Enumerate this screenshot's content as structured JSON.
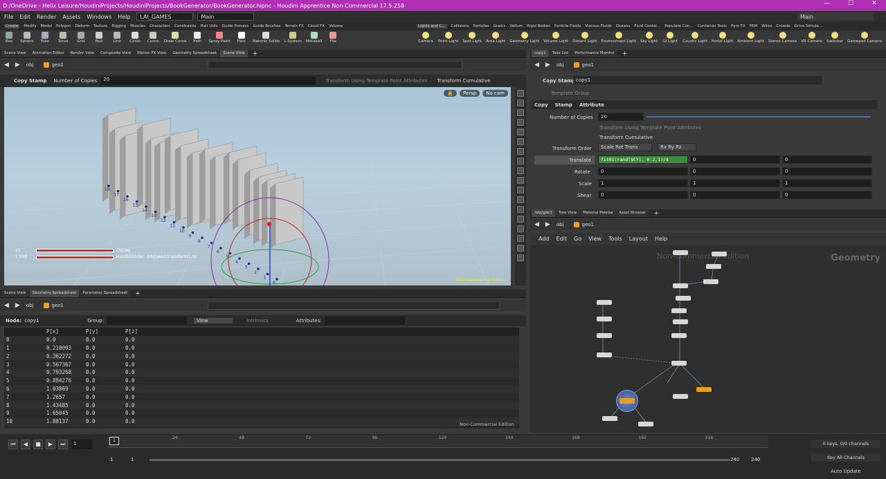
{
  "window": {
    "title": "D:/OneDrive - Helix Leisure/HoudiniProjects/HoudiniProjects/BookGenerator/BookGenerator.hipnc - Houdini Apprentice Non-Commercial 17.5.258"
  },
  "menu": {
    "items": [
      "File",
      "Edit",
      "Render",
      "Assets",
      "Windows",
      "Help"
    ],
    "desktop": "LAI_GAMES",
    "context": "Main",
    "right_context": "Main"
  },
  "shelf": {
    "tabs": [
      "Create",
      "Modify",
      "Model",
      "Polygon",
      "Deform",
      "Texture",
      "Rigging",
      "Muscles",
      "Characters",
      "Constraints",
      "Hair Utils",
      "Guide Process",
      "Guide Brushes",
      "Terrain FX",
      "Cloud FX",
      "Volume"
    ],
    "tools": [
      "Box",
      "Sphere",
      "Tube",
      "Torus",
      "Grid",
      "Null",
      "Line",
      "Circle",
      "Curve",
      "Draw Curve",
      "Path",
      "Spray Paint",
      "Font",
      "Platonic Solids",
      "L-System",
      "Metaball",
      "File"
    ],
    "tabs2": [
      "Lights and C...",
      "Collisions",
      "Particles",
      "Grains",
      "Vellum",
      "Rigid Bodies",
      "Particle Fluids",
      "Viscous Fluids",
      "Oceans",
      "Fluid Contai...",
      "Populate Con...",
      "Container Tools",
      "Pyro FX",
      "FEM",
      "Wires",
      "Crowds",
      "Drive Simula..."
    ],
    "tools2": [
      "Camera",
      "Point Light",
      "Spot Light",
      "Area Light",
      "Geometry Light",
      "Volume Light",
      "Distant Light",
      "Environment Light",
      "Sky Light",
      "GI Light",
      "Caustic Light",
      "Portal Light",
      "Ambient Light",
      "Stereo Camera",
      "VR Camera",
      "Switcher",
      "Gamepad Camera"
    ]
  },
  "left_pane": {
    "tabs": [
      "Scene View",
      "Animation Editor",
      "Render View",
      "Composite View",
      "Motion FX View",
      "Geometry Spreadsheet",
      "Scene View"
    ],
    "path": [
      "obj",
      "geo1"
    ]
  },
  "viewport": {
    "node_label": "Copy Stamp",
    "copies_label": "Number of Copies",
    "copies_value": "20",
    "opt1": "Transform Using Template Point Attributes",
    "opt2": "Transform Cumulative",
    "persp": "Persp",
    "cam": "No cam",
    "watermark": "Non-Commercial Edition",
    "hud_value1": "20",
    "hud_value2": "1.000",
    "hud_label1": "Copies",
    "hud_label2": "HoudiniSlider: /obj/geo1/transform1:sx",
    "point_labels": [
      "18",
      "17",
      "16",
      "15",
      "14",
      "13",
      "12",
      "11",
      "10",
      "9",
      "8",
      "7",
      "6",
      "5",
      "4",
      "3",
      "2",
      "1",
      "0"
    ]
  },
  "spreadsheet": {
    "tabs": [
      "Scene View",
      "Geometry Spreadsheet",
      "Parameter Spreadsheet"
    ],
    "path": [
      "obj",
      "geo1"
    ],
    "node_label": "Node:",
    "node": "copy1",
    "group_label": "Group:",
    "view": "View",
    "intrinsics": "Intrinsics",
    "attributes_label": "Attributes:",
    "columns": [
      "",
      "P[x]",
      "P[y]",
      "P[z]"
    ],
    "rows": [
      [
        "0",
        "0.0",
        "0.0",
        "0.0"
      ],
      [
        "1",
        "0.210093",
        "0.0",
        "0.0"
      ],
      [
        "2",
        "0.362272",
        "0.0",
        "0.0"
      ],
      [
        "3",
        "0.567367",
        "0.0",
        "0.0"
      ],
      [
        "4",
        "0.793268",
        "0.0",
        "0.0"
      ],
      [
        "5",
        "0.884276",
        "0.0",
        "0.0"
      ],
      [
        "6",
        "1.03869",
        "0.0",
        "0.0"
      ],
      [
        "7",
        "1.2657",
        "0.0",
        "0.0"
      ],
      [
        "8",
        "1.43485",
        "0.0",
        "0.0"
      ],
      [
        "9",
        "1.65045",
        "0.0",
        "0.0"
      ],
      [
        "10",
        "1.88137",
        "0.0",
        "0.0"
      ]
    ],
    "watermark": "Non-Commercial Edition"
  },
  "params": {
    "tabs": [
      "copy1",
      "Take List",
      "Performance Monitor"
    ],
    "path": [
      "obj",
      "geo1"
    ],
    "type": "Copy Stamp",
    "name": "copy1",
    "template_group": "Template Group",
    "subtabs": [
      "Copy",
      "Stamp",
      "Attribute"
    ],
    "num_copies_label": "Number of Copies",
    "num_copies": "20",
    "opt1": "Transform Using Template Point Attributes",
    "opt2": "Transform Cumulative",
    "order_label": "Transform Order",
    "order": "Scale Rot Trans",
    "rot_order": "Rx Ry Rz",
    "translate_label": "Translate",
    "translate": [
      "fit01(rand($CY), 0.2,1)/4",
      "0",
      "0"
    ],
    "rotate_label": "Rotate",
    "rotate": [
      "0",
      "0",
      "0"
    ],
    "scale_label": "Scale",
    "scale": [
      "1",
      "1",
      "1"
    ],
    "shear_label": "Shear",
    "shear": [
      "0",
      "0",
      "0"
    ]
  },
  "network": {
    "tabs": [
      "/obj/geo1",
      "Tree View",
      "Material Palette",
      "Asset Browser"
    ],
    "path": [
      "obj",
      "geo1"
    ],
    "menu": [
      "Add",
      "Edit",
      "Go",
      "View",
      "Tools",
      "Layout",
      "Help"
    ],
    "watermark": "Non-Commercial Edition",
    "context_label": "Geometry"
  },
  "timeline": {
    "frame": "1",
    "start": "1",
    "start2": "1",
    "end": "240",
    "end2": "240",
    "ticks": [
      "24",
      "48",
      "72",
      "96",
      "120",
      "144",
      "168",
      "192",
      "216"
    ],
    "keys": "0 keys, 0/0 channels",
    "key_all": "Key All Channels",
    "auto_update": "Auto Update"
  }
}
